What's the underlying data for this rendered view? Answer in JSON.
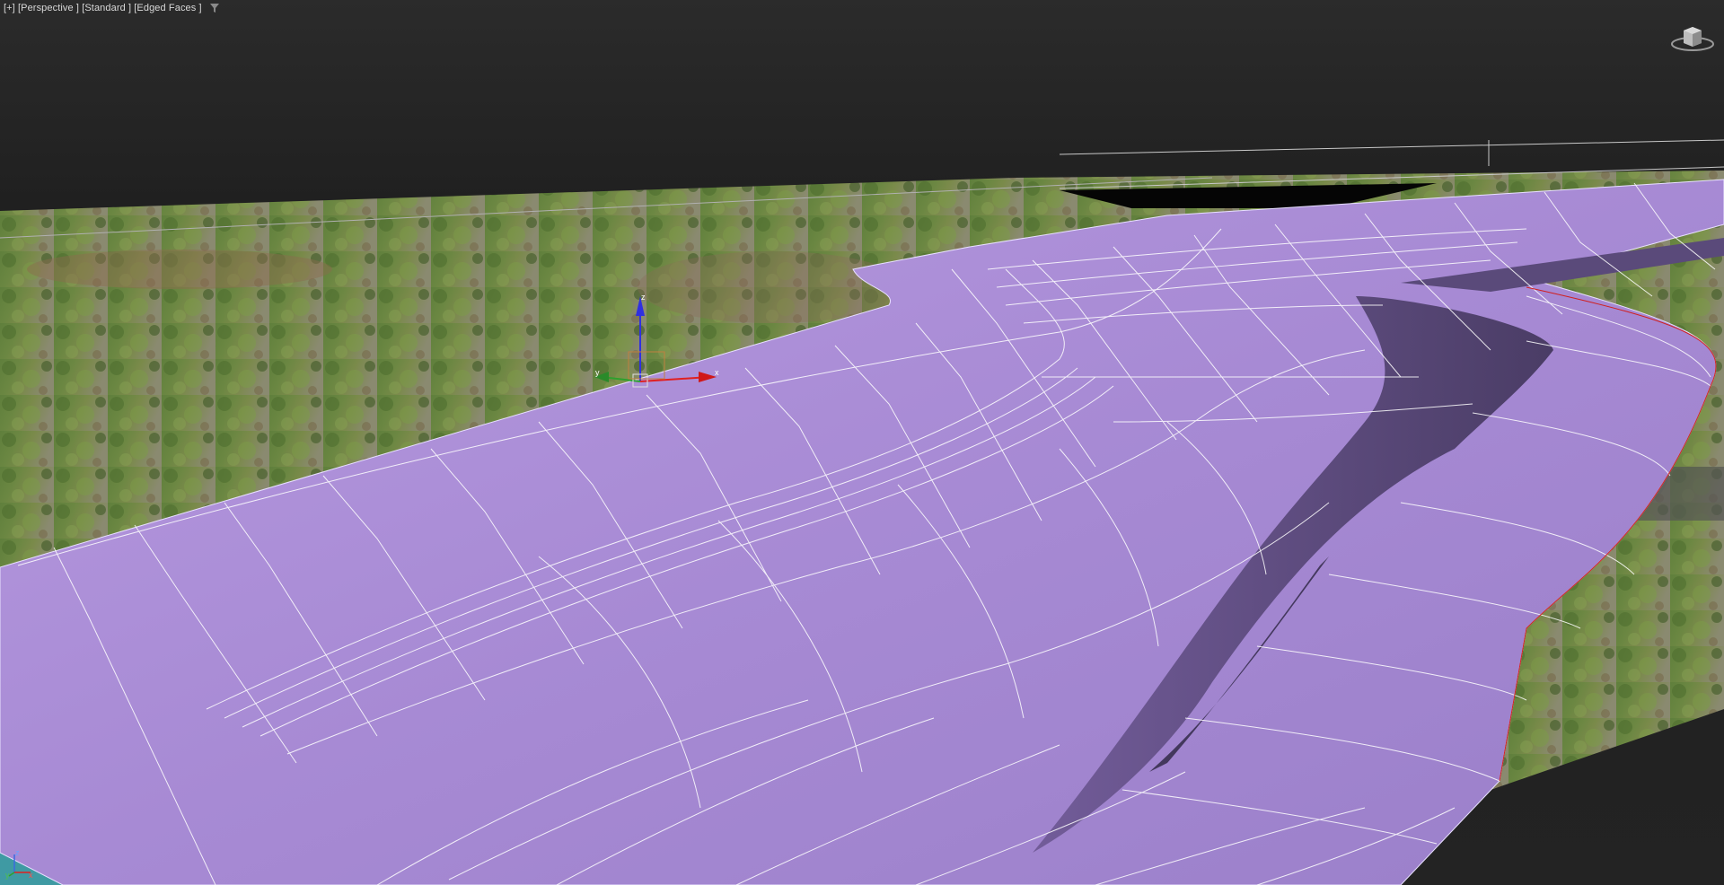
{
  "viewport": {
    "label_plus": "[+]",
    "label_view": "[Perspective ]",
    "label_shading": "[Standard ]",
    "label_display": "[Edged Faces ]",
    "filter_icon": "funnel-icon"
  },
  "gizmo": {
    "x_label": "x",
    "y_label": "y",
    "z_label": "z"
  },
  "tripod": {
    "x_label": "x",
    "y_label": "y",
    "z_label": "z"
  },
  "colors": {
    "background": "#232323",
    "mesh_purple": "#a98bd6",
    "mesh_edges": "#ffffff",
    "ground_green": "#5b7a3a",
    "teal_object": "#3f9aa3",
    "axis_x": "#e02020",
    "axis_y": "#2ea02e",
    "axis_z": "#2a2ad0"
  }
}
